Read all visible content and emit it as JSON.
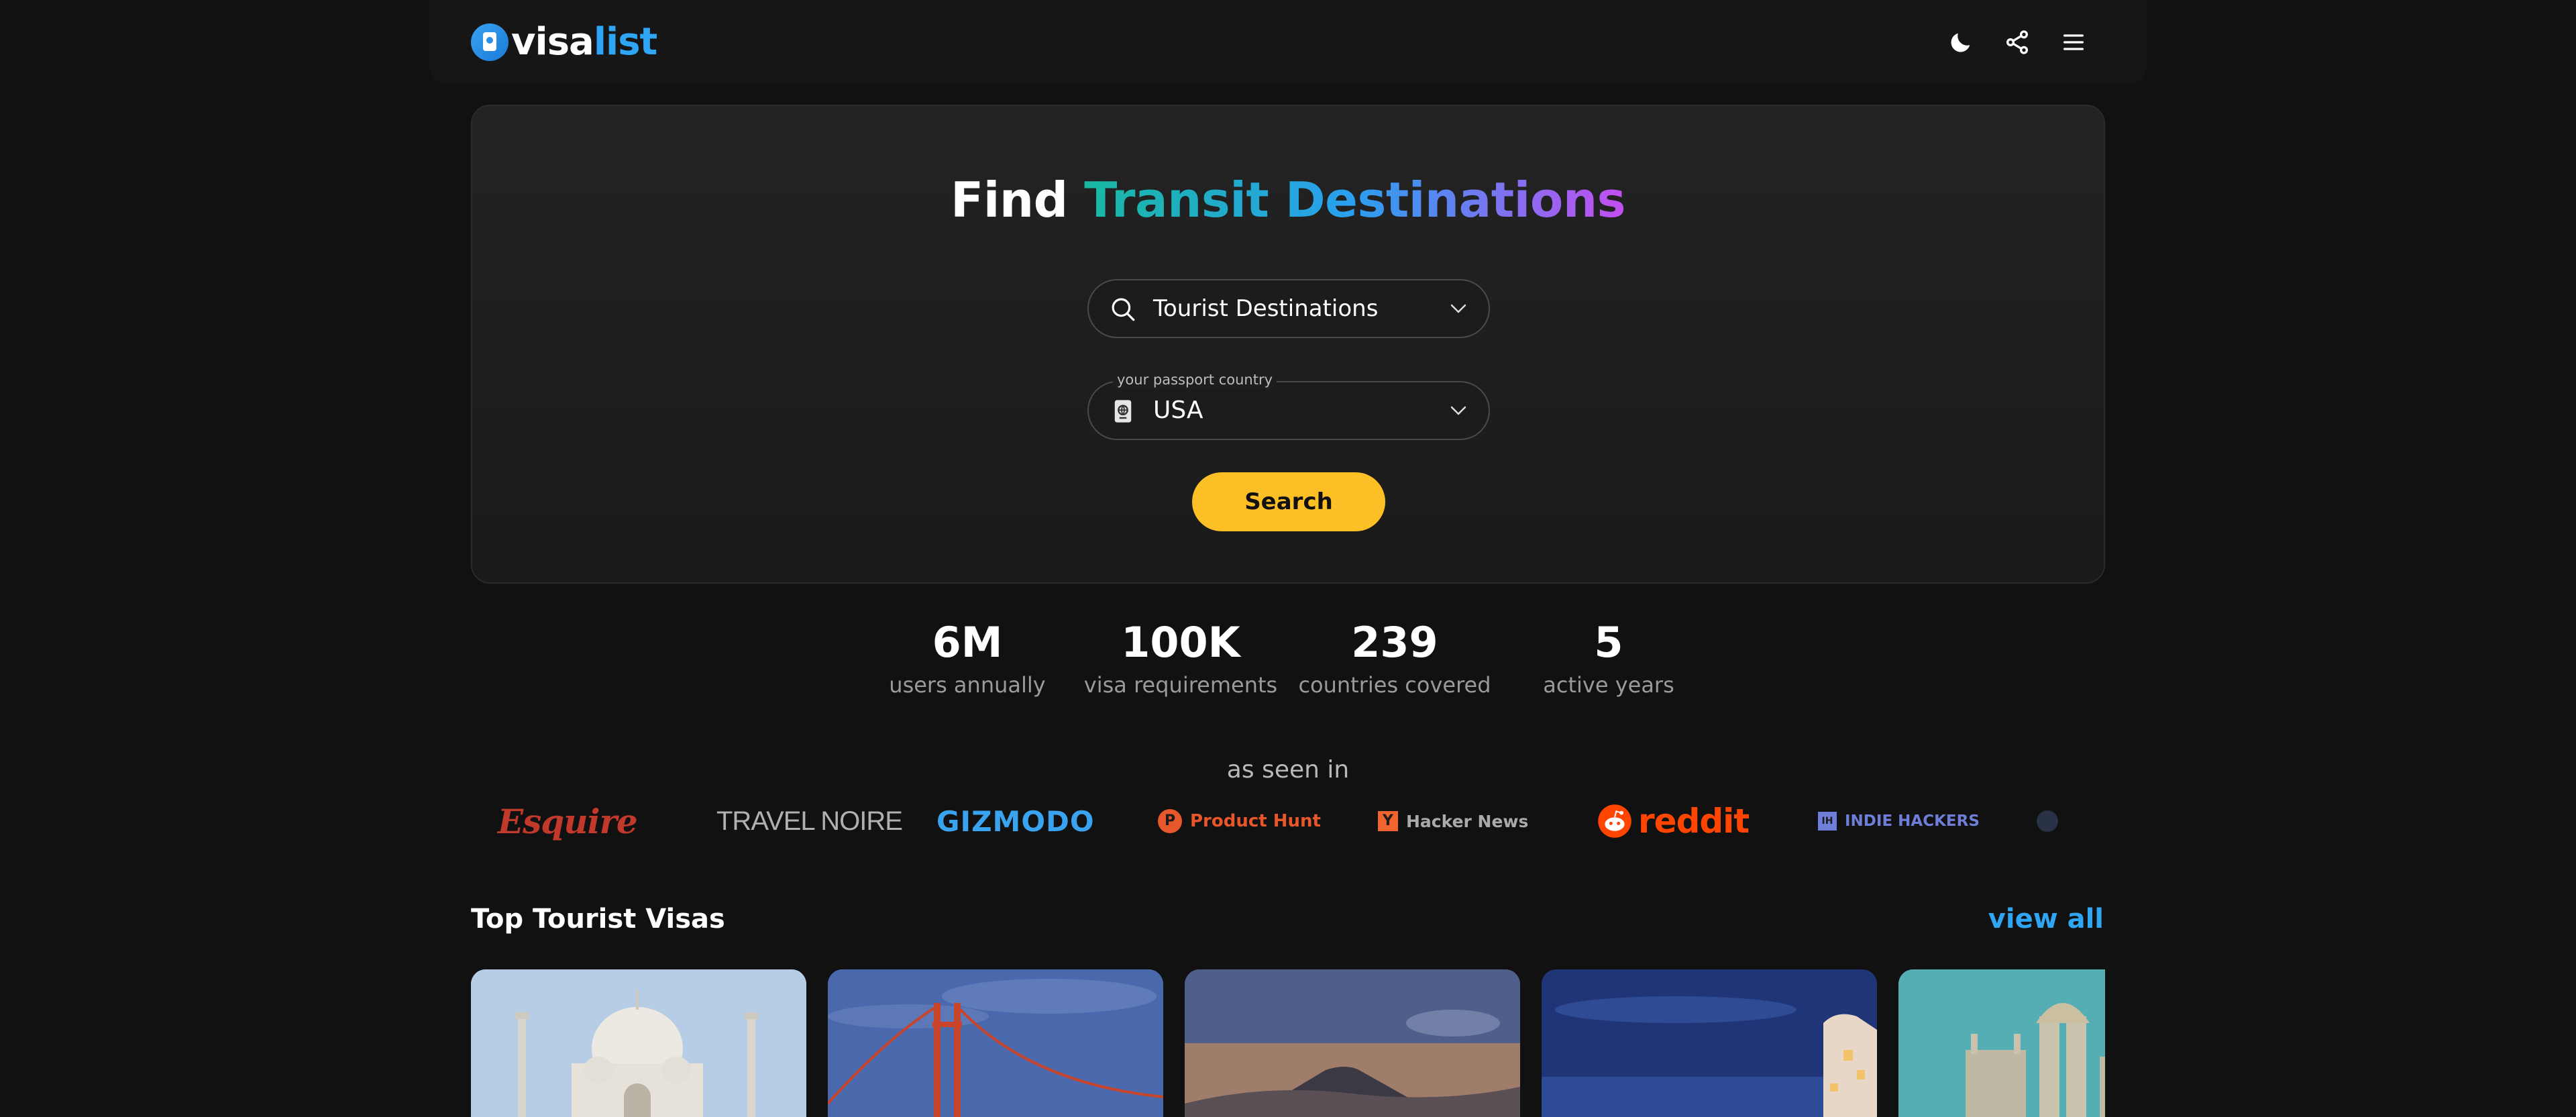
{
  "header": {
    "logo_part1": "visa",
    "logo_part2": "list",
    "icons": [
      "moon-icon",
      "share-icon",
      "menu-icon"
    ]
  },
  "hero": {
    "title_plain": "Find",
    "title_highlight": "Transit Destinations",
    "category_select": {
      "value": "Tourist Destinations",
      "icon": "search-icon"
    },
    "passport_select": {
      "label": "your passport country",
      "value": "USA",
      "icon": "passport-icon"
    },
    "search_label": "Search"
  },
  "stats": [
    {
      "value": "6M",
      "label": "users annually"
    },
    {
      "value": "100K",
      "label": "visa requirements"
    },
    {
      "value": "239",
      "label": "countries covered"
    },
    {
      "value": "5",
      "label": "active years"
    }
  ],
  "press": {
    "title": "as seen in",
    "logos": [
      "Esquire",
      "TRAVEL NOIRE",
      "GIZMODO",
      "Product Hunt",
      "Hacker News",
      "reddit",
      "INDIE HACKERS"
    ],
    "product_hunt_mark": "P",
    "hacker_news_mark": "Y",
    "indie_hackers_mark": "IH"
  },
  "section": {
    "title": "Top Tourist Visas",
    "view_all": "view all"
  },
  "colors": {
    "accent_blue": "#2ea6f3",
    "search_button": "#fcbf25",
    "background": "#111111"
  }
}
